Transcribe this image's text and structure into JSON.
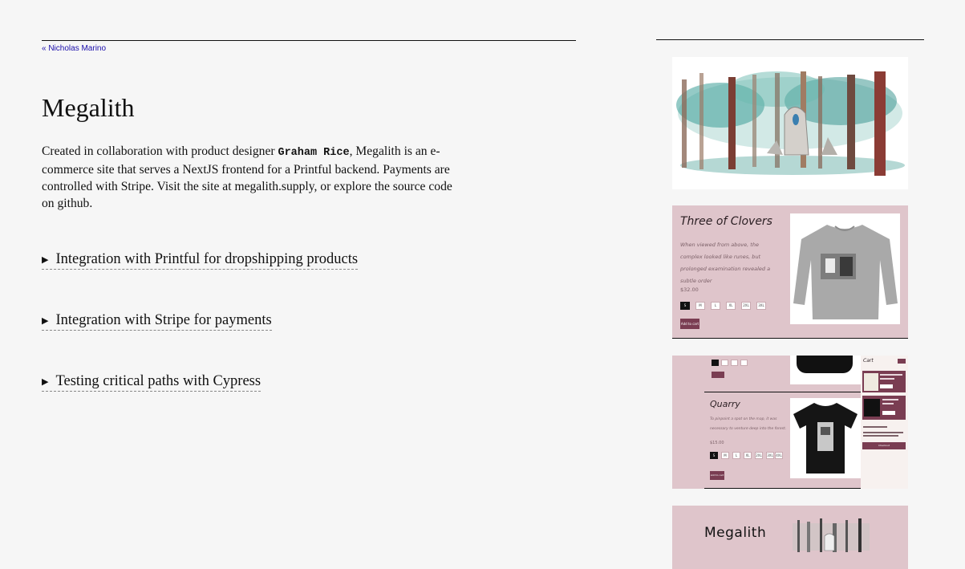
{
  "nav": {
    "back_link": "« Nicholas Marino"
  },
  "project": {
    "title": "Megalith",
    "intro_prefix": "Created in collaboration with product designer ",
    "collaborator": "Graham Rice",
    "intro_suffix": ", Megalith is an e-commerce site that serves a NextJS frontend for a Printful backend. Payments are controlled with Stripe. Visit the site at megalith.supply, or explore the source code on github."
  },
  "sections": [
    {
      "label": "Integration with Printful for dropshipping products"
    },
    {
      "label": "Integration with Stripe for payments"
    },
    {
      "label": "Testing critical paths with Cypress"
    }
  ],
  "screenshots": {
    "product_one": {
      "name": "Three of Clovers",
      "description": "When viewed from above, the complex looked like runes, but prolonged examination revealed a subtle order",
      "price": "$32.00",
      "sizes": [
        "S",
        "M",
        "L",
        "XL",
        "2XL",
        "3XL"
      ],
      "add_label": "Add to cart"
    },
    "product_two": {
      "name": "Quarry",
      "description": "To pinpoint a spot on the map, it was necessary to venture deep into the forest.",
      "price": "$15.00",
      "sizes": [
        "S",
        "M",
        "L",
        "XL",
        "2XL",
        "3XL",
        "4XL"
      ],
      "add_label": "Add to cart",
      "cart_title": "Cart",
      "cart_checkout": "Checkout"
    },
    "banner": {
      "logo": "Megalith"
    }
  },
  "colors": {
    "accent": "#7a3d52",
    "panel": "#dfc5cb",
    "link": "#1a0dab"
  }
}
